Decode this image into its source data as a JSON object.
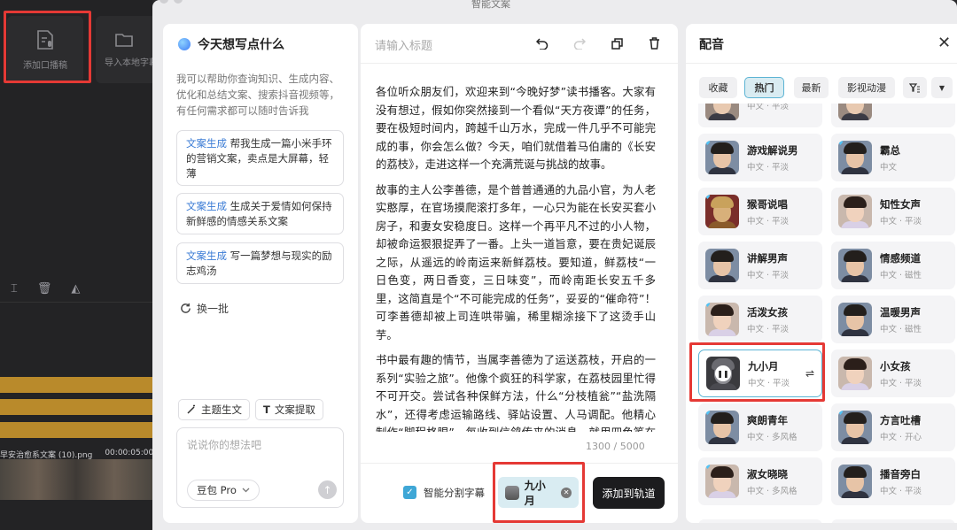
{
  "modal": {
    "title": "智能文案"
  },
  "background": {
    "tools": [
      {
        "label": "添加口播稿",
        "icon": "document-mic-icon"
      },
      {
        "label": "导入本地字幕",
        "icon": "folder-icon"
      }
    ],
    "clip_label": "早安治愈系文案 (10).png",
    "clip_time": "00:00:05:00"
  },
  "assistant": {
    "title": "今天想写点什么",
    "description": "我可以帮助你查询知识、生成内容、优化和总结文案、搜索抖音视频等，有任何需求都可以随时告诉我",
    "suggestions": [
      {
        "tag": "文案生成",
        "text": "帮我生成一篇小米手环的营销文案，卖点是大屏幕，轻薄"
      },
      {
        "tag": "文案生成",
        "text": "生成关于爱情如何保持新鲜感的情感关系文案"
      },
      {
        "tag": "文案生成",
        "text": "写一篇梦想与现实的励志鸡汤"
      }
    ],
    "refresh_label": "换一批",
    "chips": [
      "主题生文",
      "文案提取"
    ],
    "input_placeholder": "说说你的想法吧",
    "model": "豆包 Pro"
  },
  "editor": {
    "title_placeholder": "请输入标题",
    "paragraphs": [
      "各位听众朋友们，欢迎来到“今晚好梦”读书播客。大家有没有想过，假如你突然接到一个看似“天方夜谭”的任务，要在极短时间内，跨越千山万水，完成一件几乎不可能完成的事，你会怎么做？今天，咱们就借着马伯庸的《长安的荔枝》，走进这样一个充满荒诞与挑战的故事。",
      "故事的主人公李善德，是个普普通通的九品小官，为人老实憨厚，在官场摸爬滚打多年，一心只为能在长安买套小房子，和妻女安稳度日。这样一个再平凡不过的小人物，却被命运狠狠捉弄了一番。上头一道旨意，要在贵妃诞辰之际，从遥远的岭南运来新鲜荔枝。要知道，鲜荔枝“一日色变，两日香变，三日味变”，而岭南距长安五千多里，这简直是个“不可能完成的任务”，妥妥的“催命符”！可李善德却被上司连哄带骗，稀里糊涂接下了这烫手山芋。",
      "书中最有趣的情节，当属李善德为了运送荔枝，开启的一系列“实验之旅”。他像个疯狂的科学家，在荔枝园里忙得不可开交。尝试各种保鲜方法，什么“分枝植瓮”“盐洗隔水”，还得考虑运输路线、驿站设置、人马调配。他精心制作“脚程格眼”，每收到信鸽传来的消息，就用四色笔在格眼簿上标记荔枝的变化。那认真劲儿，就像在解一道关乎生死的超级数学难题。在这个过"
    ],
    "counter": "1300 / 5000",
    "smart_subtitle_label": "智能分割字幕",
    "smart_subtitle_checked": true,
    "selected_voice": "九小月",
    "add_button": "添加到轨道"
  },
  "voice_panel": {
    "title": "配音",
    "tabs": [
      "收藏",
      "热门",
      "最新",
      "影视动漫"
    ],
    "active_tab": "热门",
    "partial_row": [
      {
        "sub": "中文 · 平淡"
      },
      {
        "sub": ""
      }
    ],
    "voices": [
      {
        "name": "游戏解说男",
        "sub": "中文 · 平淡",
        "vip": true,
        "gender": "m"
      },
      {
        "name": "霸总",
        "sub": "中文",
        "vip": true,
        "gender": "m"
      },
      {
        "name": "猴哥说唱",
        "sub": "中文 · 平淡",
        "vip": true,
        "gender": "monkey"
      },
      {
        "name": "知性女声",
        "sub": "中文 · 平淡",
        "vip": false,
        "gender": "f"
      },
      {
        "name": "讲解男声",
        "sub": "中文 · 平淡",
        "vip": false,
        "gender": "m"
      },
      {
        "name": "情感频道",
        "sub": "中文 · 磁性",
        "vip": false,
        "gender": "m"
      },
      {
        "name": "活泼女孩",
        "sub": "中文 · 平淡",
        "vip": true,
        "gender": "f"
      },
      {
        "name": "温暖男声",
        "sub": "中文 · 磁性",
        "vip": false,
        "gender": "m"
      },
      {
        "name": "九小月",
        "sub": "中文 · 平淡",
        "vip": false,
        "gender": "cat",
        "selected": true
      },
      {
        "name": "小女孩",
        "sub": "中文 · 平淡",
        "vip": false,
        "gender": "f"
      },
      {
        "name": "爽朗青年",
        "sub": "中文 · 多风格",
        "vip": true,
        "gender": "m"
      },
      {
        "name": "方言吐槽",
        "sub": "中文 · 开心",
        "vip": true,
        "gender": "m"
      },
      {
        "name": "淑女晓晓",
        "sub": "中文 · 多风格",
        "vip": true,
        "gender": "f"
      },
      {
        "name": "播音旁白",
        "sub": "中文 · 平淡",
        "vip": false,
        "gender": "m"
      }
    ]
  },
  "colors": {
    "accent": "#5cb4d4",
    "highlight": "#e53935",
    "dark": "#1c1c1e"
  }
}
